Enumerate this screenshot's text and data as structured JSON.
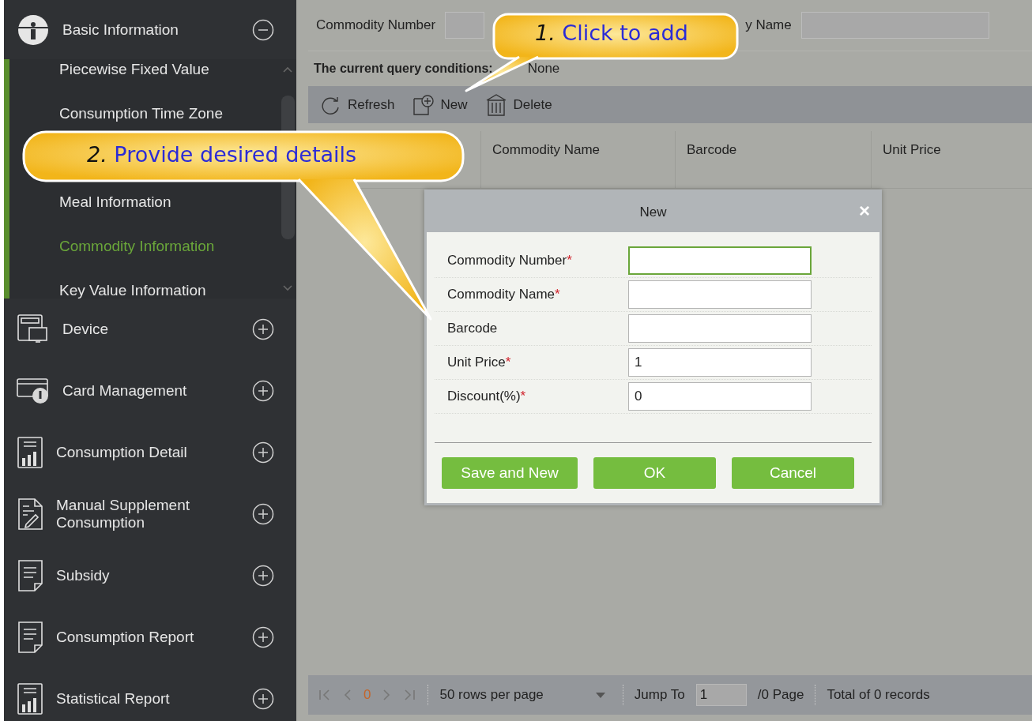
{
  "sidebar": {
    "sections": [
      {
        "label": "Basic Information",
        "expanded": true,
        "children": [
          {
            "label": "Piecewise Fixed Value",
            "selected": false
          },
          {
            "label": "Consumption Time Zone",
            "selected": false
          },
          {
            "label": "Meal Information",
            "selected": false
          },
          {
            "label": "Commodity Information",
            "selected": true
          },
          {
            "label": "Key Value Information",
            "selected": false
          }
        ]
      },
      {
        "label": "Device",
        "expanded": false
      },
      {
        "label": "Card Management",
        "expanded": false
      },
      {
        "label": "Consumption Detail",
        "expanded": false
      },
      {
        "label": "Manual Supplement Consumption",
        "expanded": false
      },
      {
        "label": "Subsidy",
        "expanded": false
      },
      {
        "label": "Consumption Report",
        "expanded": false
      },
      {
        "label": "Statistical Report",
        "expanded": false
      }
    ]
  },
  "search": {
    "fields": [
      {
        "label": "Commodity Number"
      },
      {
        "label": "y Name"
      }
    ]
  },
  "query_conditions": {
    "label": "The current query conditions:",
    "value": "None"
  },
  "toolbar": [
    "Refresh",
    "New",
    "Delete"
  ],
  "table": {
    "columns": [
      "Commodity Name",
      "Barcode",
      "Unit Price"
    ]
  },
  "pagination": {
    "page": "0",
    "rows_per_page": "50 rows per page",
    "jump_label": "Jump To",
    "jump_value": "1",
    "pages": "/0 Page",
    "total": "Total of 0 records"
  },
  "dialog": {
    "title": "New",
    "close": "×",
    "fields": [
      {
        "label": "Commodity Number",
        "mark": "*",
        "focused": true
      },
      {
        "label": "Commodity Name",
        "mark": "*",
        "focused": false
      },
      {
        "label": "Barcode",
        "focused": false
      },
      {
        "label": "Unit Price",
        "mark": "*",
        "value": "1",
        "focused": false
      },
      {
        "label": "Discount(%)",
        "mark": "*",
        "value": "0",
        "focused": false
      }
    ],
    "buttons": [
      "Save and New",
      "OK",
      "Cancel"
    ]
  },
  "callouts": [
    {
      "step": "1.",
      "text": "Click to add"
    },
    {
      "step": "2.",
      "text": "Provide desired details"
    }
  ]
}
